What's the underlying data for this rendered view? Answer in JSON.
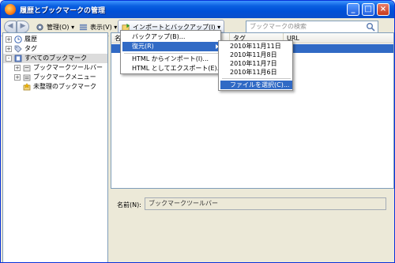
{
  "window": {
    "title": "履歴とブックマークの管理",
    "controls": {
      "minimize": "_",
      "maximize": "□",
      "close": "×"
    }
  },
  "toolbar": {
    "back_icon": "◀",
    "forward_icon": "▶",
    "manage_label": "管理(O)",
    "view_label": "表示(V)",
    "import_backup_label": "インポートとバックアップ(I)",
    "search_placeholder": "ブックマークの検索"
  },
  "sidebar": {
    "items": [
      {
        "label": "履歴",
        "toggle": "+",
        "icon": "clock-icon"
      },
      {
        "label": "タグ",
        "toggle": "+",
        "icon": "tag-icon"
      },
      {
        "label": "すべてのブックマーク",
        "toggle": "-",
        "icon": "bookmarks-icon",
        "selected": true
      },
      {
        "label": "ブックマークツールバー",
        "toggle": "+",
        "icon": "folder-icon"
      },
      {
        "label": "ブックマークメニュー",
        "toggle": "+",
        "icon": "folder-icon"
      },
      {
        "label": "未整理のブックマーク",
        "icon": "unsorted-bookmarks-icon"
      }
    ]
  },
  "list": {
    "columns": [
      "名",
      "タグ",
      "URL"
    ]
  },
  "details": {
    "name_label": "名前(N):",
    "name_value": "ブックマークツールバー"
  },
  "import_menu": {
    "items": [
      {
        "label": "バックアップ(B)..."
      },
      {
        "label": "復元(R)",
        "highlighted": true,
        "has_submenu": true
      },
      {
        "label": "HTML からインポート(I)..."
      },
      {
        "label": "HTML としてエクスポート(E)..."
      }
    ]
  },
  "restore_menu": {
    "items": [
      {
        "label": "2010年11月11日"
      },
      {
        "label": "2010年11月8日"
      },
      {
        "label": "2010年11月7日"
      },
      {
        "label": "2010年11月6日"
      },
      {
        "label": "ファイルを選択(C)...",
        "highlighted": true
      }
    ]
  },
  "colors": {
    "title_bar": "#0a5fe0",
    "selection": "#316ac5",
    "chrome": "#ece9d8"
  }
}
